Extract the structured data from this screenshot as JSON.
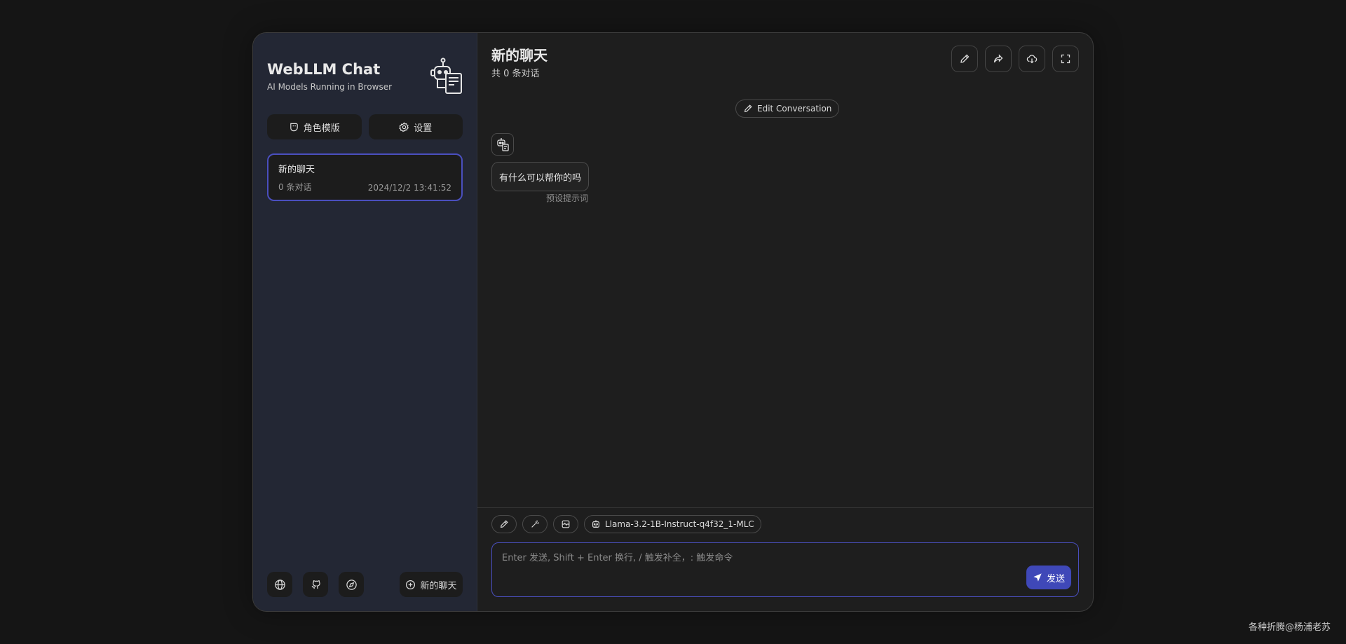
{
  "sidebar": {
    "title": "WebLLM Chat",
    "subtitle": "AI Models Running in Browser",
    "buttons": {
      "templates": "角色模版",
      "settings": "设置"
    },
    "chats": [
      {
        "title": "新的聊天",
        "count": "0 条对话",
        "date": "2024/12/2 13:41:52"
      }
    ],
    "footer": {
      "new_chat": "新的聊天"
    }
  },
  "header": {
    "title": "新的聊天",
    "subtitle": "共 0 条对话"
  },
  "conversation": {
    "edit_label": "Edit Conversation",
    "messages": [
      {
        "text": "有什么可以帮你的吗",
        "note": "预设提示词"
      }
    ]
  },
  "input": {
    "model": "Llama-3.2-1B-Instruct-q4f32_1-MLC",
    "placeholder": "Enter 发送, Shift + Enter 换行, / 触发补全，: 触发命令",
    "send_label": "发送"
  },
  "watermark": "各种折腾@杨浦老苏",
  "colors": {
    "accent": "#3f48b8",
    "selected_border": "#4a4fbf",
    "sidebar_bg": "#232734"
  }
}
